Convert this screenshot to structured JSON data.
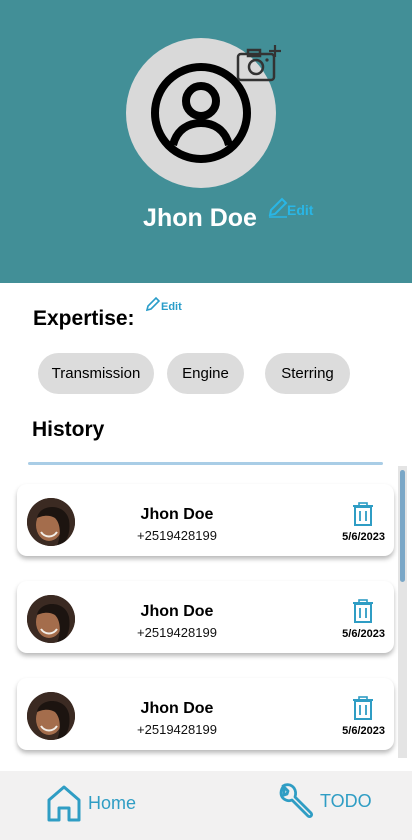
{
  "profile": {
    "name": "Jhon Doe",
    "edit_label": "Edit",
    "avatar_icon": "user-circle-icon",
    "camera_icon": "add-photo-icon"
  },
  "expertise": {
    "title": "Expertise:",
    "edit_label": "Edit",
    "chips": [
      "Transmission",
      "Engine",
      "Sterring"
    ]
  },
  "history": {
    "title": "History",
    "items": [
      {
        "name": "Jhon Doe",
        "phone": "+2519428199",
        "date": "5/6/2023"
      },
      {
        "name": "Jhon Doe",
        "phone": "+2519428199",
        "date": "5/6/2023"
      },
      {
        "name": "Jhon Doe",
        "phone": "+2519428199",
        "date": "5/6/2023"
      }
    ]
  },
  "nav": {
    "home_label": "Home",
    "todo_label": "TODO"
  },
  "colors": {
    "header": "#428f97",
    "accent": "#2f9dc4",
    "chip": "#dcdcdc"
  }
}
